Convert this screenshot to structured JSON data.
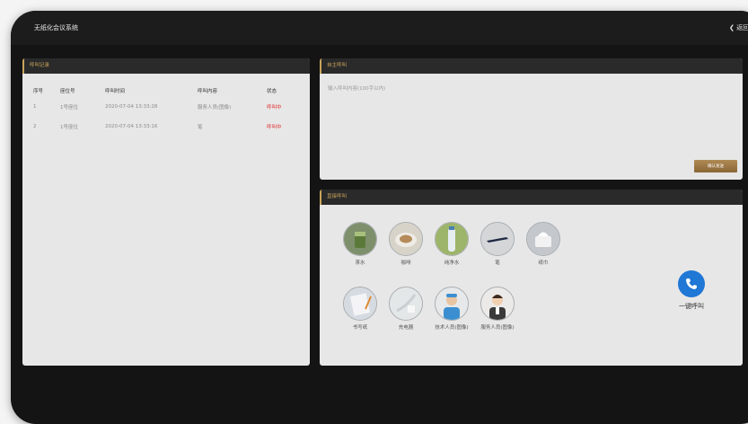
{
  "app": {
    "title": "无纸化会议系统",
    "back_label": "❮ 返回"
  },
  "call_records": {
    "title": "呼叫记录",
    "columns": [
      "序号",
      "座位号",
      "呼叫时间",
      "呼叫内容",
      "状态"
    ],
    "rows": [
      {
        "index": "1",
        "seat": "1号座位",
        "time": "2020-07-04 13:33:28",
        "content": "服务人员(图像)",
        "status": "呼叫中"
      },
      {
        "index": "2",
        "seat": "1号座位",
        "time": "2020-07-04 13:33:16",
        "content": "笔",
        "status": "呼叫中"
      }
    ]
  },
  "custom_call": {
    "title": "自主呼叫",
    "placeholder": "输入呼叫内容(100字以内)",
    "send_label": "确认发送"
  },
  "quick_call": {
    "title": "直接呼叫",
    "items": [
      {
        "label": "茶水",
        "icon": "tea-icon"
      },
      {
        "label": "咖啡",
        "icon": "coffee-icon"
      },
      {
        "label": "纯净水",
        "icon": "water-icon"
      },
      {
        "label": "笔",
        "icon": "pen-icon"
      },
      {
        "label": "纸巾",
        "icon": "tissue-icon"
      },
      {
        "label": "书写纸",
        "icon": "writing-paper-icon"
      },
      {
        "label": "充电器",
        "icon": "charger-icon"
      },
      {
        "label": "技术人员(图像)",
        "icon": "technician-icon"
      },
      {
        "label": "服务人员(图像)",
        "icon": "service-staff-icon"
      }
    ],
    "one_click": {
      "label": "一键呼叫",
      "icon": "phone-call-icon"
    }
  },
  "colors": {
    "accent_gold": "#c9a45c",
    "status_red": "#e03030",
    "call_blue": "#1f77d6"
  }
}
